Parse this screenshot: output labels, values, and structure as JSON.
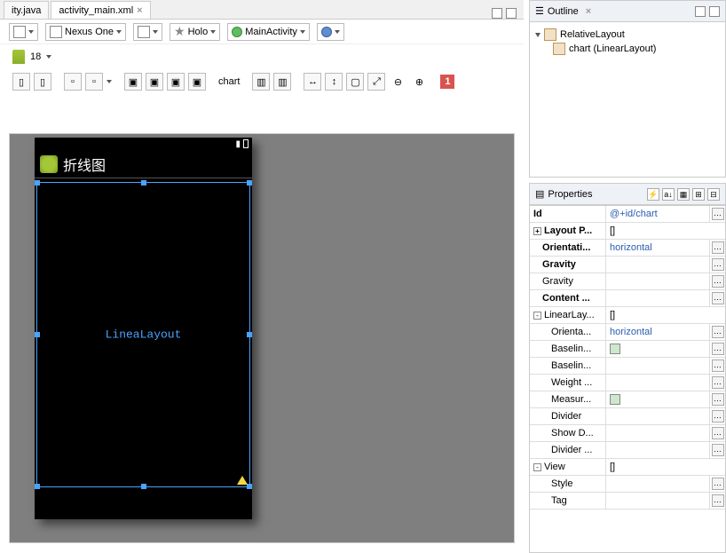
{
  "tabs": {
    "inactive": "ity.java",
    "active": "activity_main.xml"
  },
  "config": {
    "device": "Nexus One",
    "theme": "Holo",
    "activity": "MainActivity"
  },
  "api": "18",
  "toolbar": {
    "chart_label": "chart",
    "warn_count": "1"
  },
  "device": {
    "app_title": "折线图",
    "selected_label": "LineaLayout"
  },
  "outline": {
    "title": "Outline",
    "root": "RelativeLayout",
    "child": "chart (LinearLayout)"
  },
  "properties": {
    "title": "Properties",
    "rows": [
      {
        "lbl": "Id",
        "val": "@+id/chart",
        "bold": true,
        "link": true,
        "btn": true
      },
      {
        "lbl": "Layout P...",
        "val": "[]",
        "bold": true,
        "exp": "+"
      },
      {
        "lbl": "Orientati...",
        "val": "horizontal",
        "bold": true,
        "link": true,
        "btn": true,
        "indent": 1
      },
      {
        "lbl": "Gravity",
        "val": "",
        "bold": true,
        "btn": true,
        "indent": 1
      },
      {
        "lbl": "Gravity",
        "val": "",
        "btn": true,
        "indent": 1
      },
      {
        "lbl": "Content ...",
        "val": "",
        "bold": true,
        "btn": true,
        "indent": 1
      },
      {
        "lbl": "LinearLay...",
        "val": "[]",
        "exp": "-"
      },
      {
        "lbl": "Orienta...",
        "val": "horizontal",
        "link": true,
        "btn": true,
        "indent": 2
      },
      {
        "lbl": "Baselin...",
        "val": "",
        "swatch": true,
        "btn": true,
        "indent": 2
      },
      {
        "lbl": "Baselin...",
        "val": "",
        "btn": true,
        "indent": 2
      },
      {
        "lbl": "Weight ...",
        "val": "",
        "btn": true,
        "indent": 2
      },
      {
        "lbl": "Measur...",
        "val": "",
        "swatch": true,
        "btn": true,
        "indent": 2
      },
      {
        "lbl": "Divider",
        "val": "",
        "btn": true,
        "indent": 2
      },
      {
        "lbl": "Show D...",
        "val": "",
        "btn": true,
        "indent": 2
      },
      {
        "lbl": "Divider ...",
        "val": "",
        "btn": true,
        "indent": 2
      },
      {
        "lbl": "View",
        "val": "[]",
        "exp": "-"
      },
      {
        "lbl": "Style",
        "val": "",
        "btn": true,
        "indent": 2
      },
      {
        "lbl": "Tag",
        "val": "",
        "btn": true,
        "indent": 2
      }
    ]
  }
}
